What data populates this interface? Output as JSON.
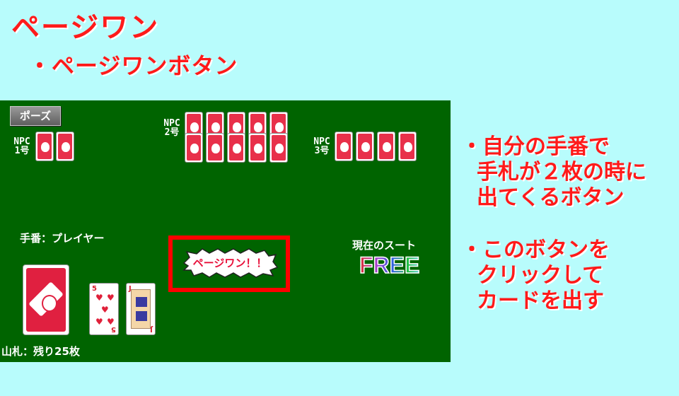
{
  "header": {
    "title": "ページワン",
    "subtitle": "・ページワンボタン"
  },
  "game": {
    "pause_label": "ポーズ",
    "npc1_label": "NPC 1号",
    "npc2_label": "NPC 2号",
    "npc3_label": "NPC 3号",
    "npc1_cards": 2,
    "npc2_cards": 10,
    "npc3_cards": 4,
    "turn_label": "手番：プレイヤー",
    "deck_label": "山札：残り25枚",
    "page_one_button": "ページワン！！",
    "current_suit_label": "現在のスート",
    "current_suit_value": "FREE",
    "hand": [
      {
        "rank": "5",
        "suit": "hearts"
      },
      {
        "rank": "J",
        "suit": "hearts"
      }
    ]
  },
  "notes": {
    "note1_line1": "・自分の手番で",
    "note1_line2": "手札が２枚の時に",
    "note1_line3": "出てくるボタン",
    "note2_line1": "・このボタンを",
    "note2_line2": "クリックして",
    "note2_line3": "カードを出す"
  },
  "colors": {
    "board": "#006400",
    "background": "#b8fcfc",
    "accent": "#ff1a1a",
    "card_back": "#e8304a"
  },
  "icons": {
    "card_back": "bunny-card-back-icon",
    "deck": "bunny-deck-icon"
  }
}
